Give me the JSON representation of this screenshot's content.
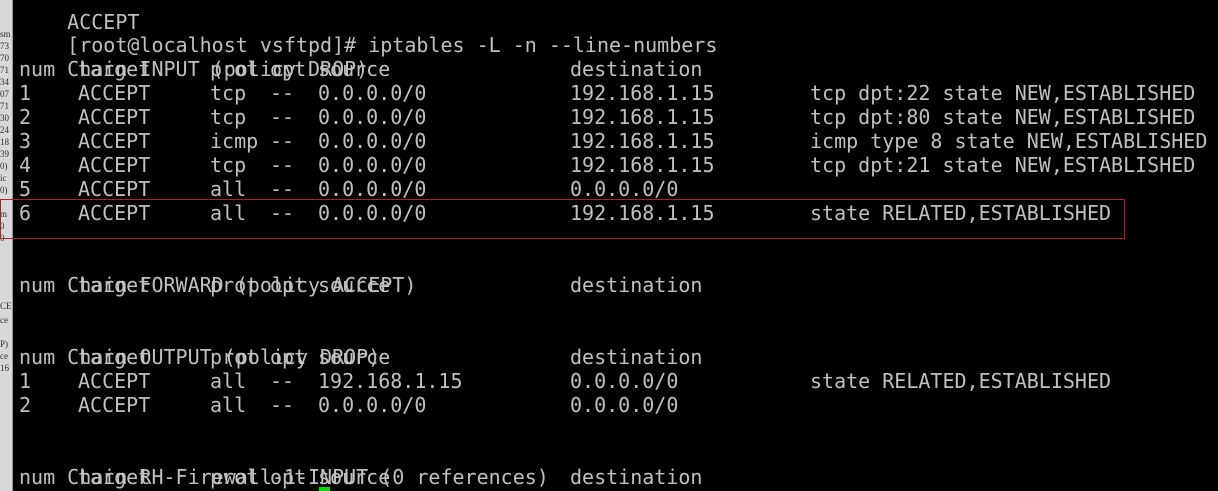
{
  "terminal": {
    "top_partial_text": "ACCEPT",
    "prompt": "[root@localhost vsftpd]# iptables -L -n --line-numbers",
    "left_strip_fragments": [
      "sm",
      "73",
      "70",
      "71",
      "34",
      "07",
      "71",
      "30",
      "24",
      "18",
      "39",
      "0)",
      "ic",
      "0)",
      "m",
      "0",
      "0",
      "CE",
      "ce",
      "P)",
      "ce",
      "16"
    ],
    "column_header": {
      "num": "num",
      "target": "target",
      "prot": "prot",
      "opt": "opt",
      "source": "source",
      "destination": "destination"
    },
    "chains": [
      {
        "title": "Chain INPUT (policy DROP)",
        "rules": [
          {
            "num": "1",
            "target": "ACCEPT",
            "prot": "tcp",
            "opt": "--",
            "source": "0.0.0.0/0",
            "destination": "192.168.1.15",
            "extra": "tcp dpt:22 state NEW,ESTABLISHED"
          },
          {
            "num": "2",
            "target": "ACCEPT",
            "prot": "tcp",
            "opt": "--",
            "source": "0.0.0.0/0",
            "destination": "192.168.1.15",
            "extra": "tcp dpt:80 state NEW,ESTABLISHED"
          },
          {
            "num": "3",
            "target": "ACCEPT",
            "prot": "icmp",
            "opt": "--",
            "source": "0.0.0.0/0",
            "destination": "192.168.1.15",
            "extra": "icmp type 8 state NEW,ESTABLISHED"
          },
          {
            "num": "4",
            "target": "ACCEPT",
            "prot": "tcp",
            "opt": "--",
            "source": "0.0.0.0/0",
            "destination": "192.168.1.15",
            "extra": "tcp dpt:21 state NEW,ESTABLISHED"
          },
          {
            "num": "5",
            "target": "ACCEPT",
            "prot": "all",
            "opt": "--",
            "source": "0.0.0.0/0",
            "destination": "0.0.0.0/0",
            "extra": ""
          },
          {
            "num": "6",
            "target": "ACCEPT",
            "prot": "all",
            "opt": "--",
            "source": "0.0.0.0/0",
            "destination": "192.168.1.15",
            "extra": "state RELATED,ESTABLISHED"
          }
        ]
      },
      {
        "title": "Chain FORWARD (policy ACCEPT)",
        "rules": []
      },
      {
        "title": "Chain OUTPUT (policy DROP)",
        "rules": [
          {
            "num": "1",
            "target": "ACCEPT",
            "prot": "all",
            "opt": "--",
            "source": "192.168.1.15",
            "destination": "0.0.0.0/0",
            "extra": "state RELATED,ESTABLISHED"
          },
          {
            "num": "2",
            "target": "ACCEPT",
            "prot": "all",
            "opt": "--",
            "source": "0.0.0.0/0",
            "destination": "0.0.0.0/0",
            "extra": ""
          }
        ]
      },
      {
        "title": "Chain RH-Firewall-1-INPUT (0 references)",
        "rules": []
      }
    ],
    "colors": {
      "background": "#000000",
      "text": "#c0c0c0",
      "highlight_border": "#b02020",
      "cursor": "#00dd00"
    }
  }
}
